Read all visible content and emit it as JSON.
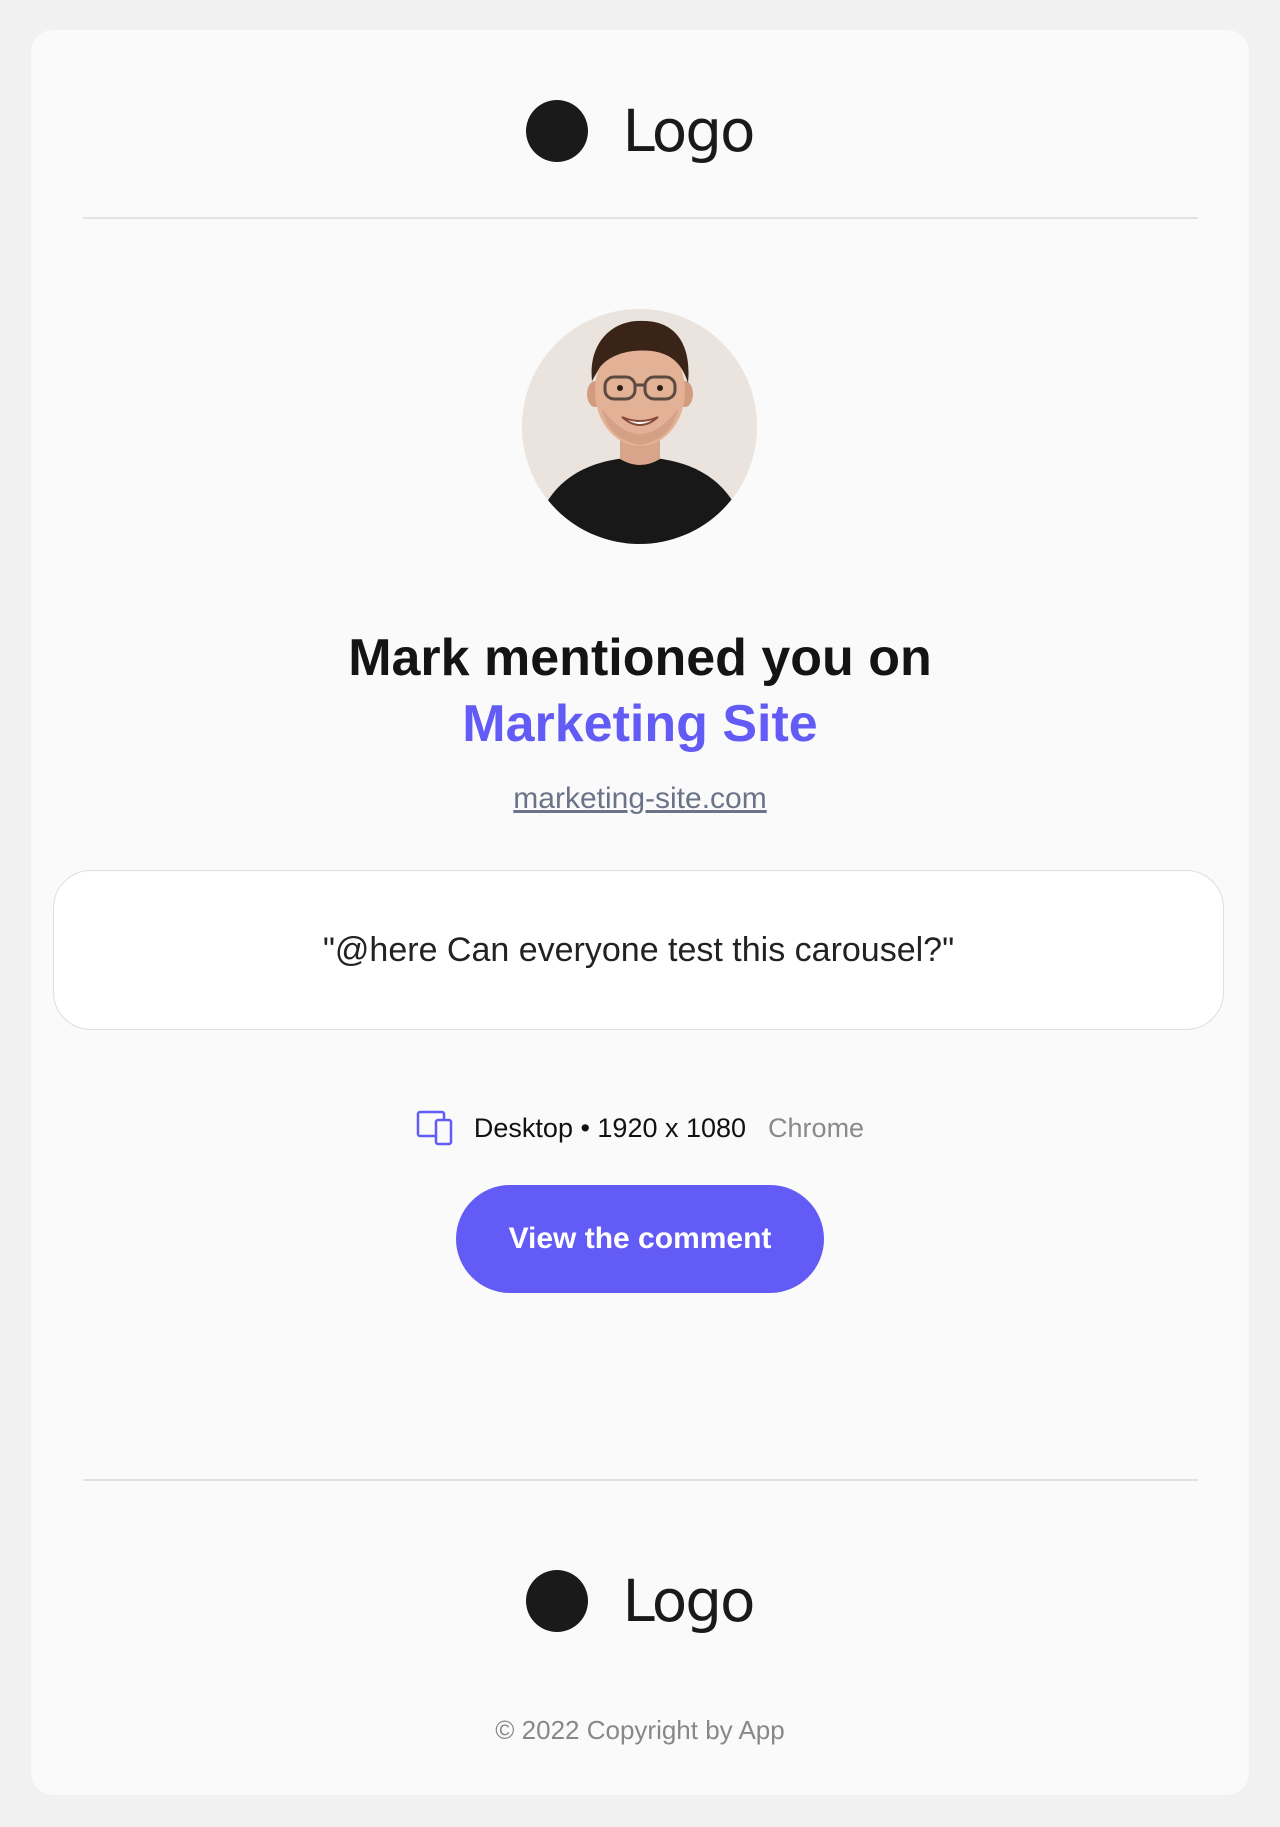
{
  "header": {
    "logo_text": "Logo"
  },
  "mention": {
    "headline_prefix": "Mark mentioned you on",
    "site_name": "Marketing Site",
    "site_url": "marketing-site.com"
  },
  "comment": {
    "text": "\"@here Can everyone test this carousel?\""
  },
  "meta": {
    "device": "Desktop • 1920 x 1080",
    "browser": "Chrome",
    "icon": "devices-icon"
  },
  "cta": {
    "label": "View the comment"
  },
  "footer": {
    "logo_text": "Logo",
    "copyright": "© 2022 Copyright by App"
  },
  "colors": {
    "accent": "#635bf5",
    "background": "#f1f1f1",
    "card": "#fafafa"
  }
}
